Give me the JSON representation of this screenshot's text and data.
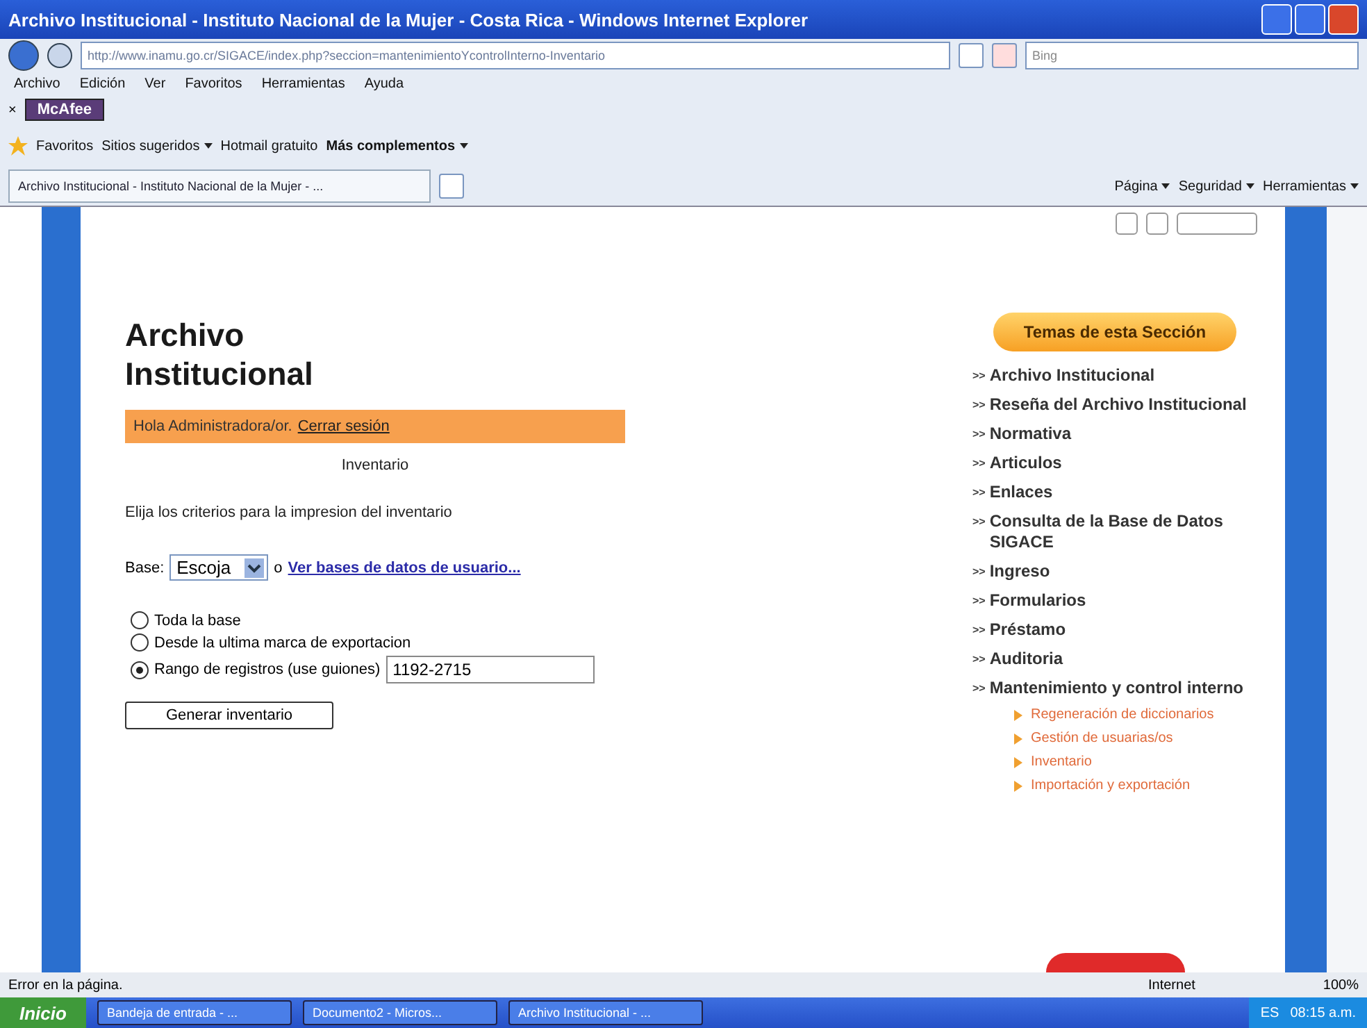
{
  "window": {
    "title": "Archivo Institucional - Instituto Nacional de la Mujer - Costa Rica - Windows Internet Explorer"
  },
  "address": {
    "url": "http://www.inamu.go.cr/SIGACE/index.php?seccion=mantenimientoYcontrolInterno-Inventario",
    "search_placeholder": "Bing"
  },
  "menu": [
    "Archivo",
    "Edición",
    "Ver",
    "Favoritos",
    "Herramientas",
    "Ayuda"
  ],
  "mcafee": {
    "close": "×",
    "label": "McAfee"
  },
  "favorites": {
    "label": "Favoritos",
    "links": [
      {
        "label": "Sitios sugeridos",
        "dropdown": true,
        "bold": false
      },
      {
        "label": "Hotmail gratuito",
        "dropdown": false,
        "bold": false
      },
      {
        "label": "Más complementos",
        "dropdown": true,
        "bold": true
      }
    ]
  },
  "tab": {
    "label": "Archivo Institucional - Instituto Nacional de la Mujer - ..."
  },
  "command_bar": [
    "Página",
    "Seguridad",
    "Herramientas"
  ],
  "page": {
    "heading": "Archivo Institucional",
    "greeting": "Hola Administradora/or.",
    "logout": "Cerrar sesión",
    "section": "Inventario",
    "instructions": "Elija los criterios para la impresion del inventario",
    "base_label": "Base:",
    "base_value": "Escoja",
    "or": "o",
    "base_link": "Ver bases de datos de usuario...",
    "options": [
      {
        "label": "Toda la base",
        "selected": false
      },
      {
        "label": "Desde la ultima marca de exportacion",
        "selected": false
      },
      {
        "label": "Rango de registros (use guiones)",
        "selected": true
      }
    ],
    "range_value": "1192-2715",
    "generate_button": "Generar inventario"
  },
  "sidebar": {
    "title": "Temas de esta Sección",
    "marker": ">>",
    "items": [
      {
        "label": "Archivo Institucional"
      },
      {
        "label": "Reseña del Archivo Institucional"
      },
      {
        "label": "Normativa"
      },
      {
        "label": "Articulos"
      },
      {
        "label": "Enlaces"
      },
      {
        "label": "Consulta de la Base de Datos SIGACE"
      },
      {
        "label": "Ingreso"
      },
      {
        "label": "Formularios"
      },
      {
        "label": "Préstamo"
      },
      {
        "label": "Auditoria"
      },
      {
        "label": "Mantenimiento y control interno",
        "children": [
          {
            "label": "Regeneración de diccionarios"
          },
          {
            "label": "Gestión de usuarias/os"
          },
          {
            "label": "Inventario"
          },
          {
            "label": "Importación y exportación"
          }
        ]
      }
    ]
  },
  "status_bar": {
    "message": "Error en la página.",
    "zone": "Internet",
    "zoom": "100%"
  },
  "taskbar": {
    "start": "Inicio",
    "items": [
      "Bandeja de entrada - ...",
      "Documento2 - Micros...",
      "Archivo Institucional - ..."
    ],
    "lang": "ES",
    "clock": "08:15 a.m."
  }
}
